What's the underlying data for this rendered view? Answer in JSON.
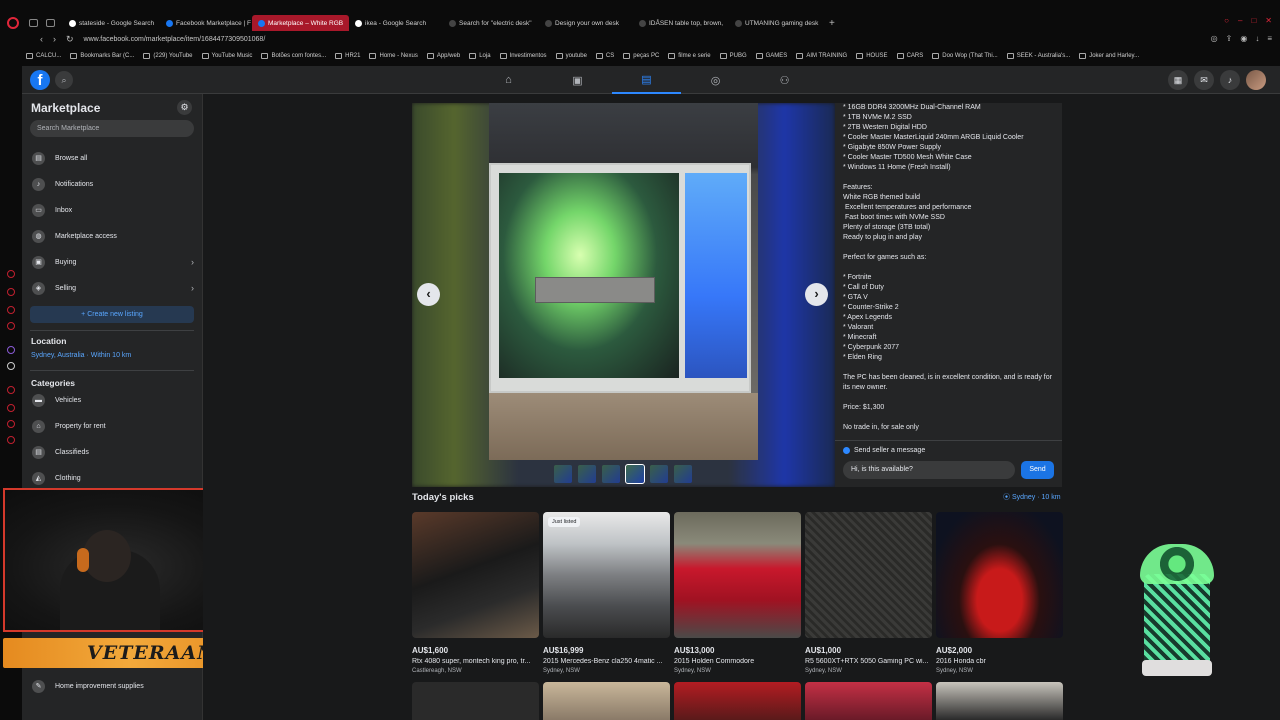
{
  "browser": {
    "tabs": [
      {
        "label": "stateside - Google Search",
        "color": "#ffffff"
      },
      {
        "label": "Facebook Marketplace | F",
        "color": "#1877f2"
      },
      {
        "label": "Marketplace – White RGB",
        "color": "#1877f2"
      },
      {
        "label": "ikea - Google Search",
        "color": "#ffffff"
      },
      {
        "label": "Search for \"electric desk\"",
        "color": "#444444"
      },
      {
        "label": "Design your own desk",
        "color": "#444444"
      },
      {
        "label": "IDÅSEN table top, brown,",
        "color": "#444444"
      },
      {
        "label": "UTMANING gaming desk",
        "color": "#444444"
      }
    ],
    "url": "www.facebook.com/marketplace/item/1684477309501068/",
    "bookmarks": [
      "CALCU...",
      "Bookmarks Bar (C...",
      "(229) YouTube",
      "YouTube Music",
      "Botões com fontes...",
      "HR21",
      "Home - Nexus",
      "App/web",
      "Loja",
      "Investimentos",
      "youtube",
      "CS",
      "peças PC",
      "filme e serie",
      "PUBG",
      "GAMES",
      "AIM TRAINING",
      "HOUSE",
      "CARS",
      "Doo Wop (That Thi...",
      "SEEK - Australia's...",
      "Joker and Harley..."
    ]
  },
  "sidebar": {
    "title": "Marketplace",
    "search_placeholder": "Search Marketplace",
    "items": [
      {
        "label": "Browse all"
      },
      {
        "label": "Notifications"
      },
      {
        "label": "Inbox"
      },
      {
        "label": "Marketplace access"
      },
      {
        "label": "Buying"
      },
      {
        "label": "Selling"
      }
    ],
    "create_label": "+ Create new listing",
    "location_heading": "Location",
    "location_value": "Sydney, Australia · Within 10 km",
    "categories_heading": "Categories",
    "categories": [
      {
        "label": "Vehicles"
      },
      {
        "label": "Property for rent"
      },
      {
        "label": "Classifieds"
      },
      {
        "label": "Clothing"
      }
    ],
    "bottom_item": "Home improvement supplies"
  },
  "overlay": {
    "banner_text": "VETERAAN"
  },
  "listing": {
    "description": "* 16GB DDR4 3200MHz Dual-Channel RAM\n* 1TB NVMe M.2 SSD\n* 2TB Western Digital HDD\n* Cooler Master MasterLiquid 240mm ARGB Liquid Cooler\n* Gigabyte 850W Power Supply\n* Cooler Master TD500 Mesh White Case\n* Windows 11 Home (Fresh Install)\n\nFeatures:\nWhite RGB themed build\n Excellent temperatures and performance\n Fast boot times with NVMe SSD\nPlenty of storage (3TB total)\nReady to plug in and play\n\nPerfect for games such as:\n\n* Fortnite\n* Call of Duty\n* GTA V\n* Counter-Strike 2\n* Apex Legends\n* Valorant\n* Minecraft\n* Cyberpunk 2077\n* Elden Ring\n\nThe PC has been cleaned, is in excellent condition, and is ready for its new owner.\n\nPrice: $1,300\n\nNo trade in, for sale only",
    "message_heading": "Send seller a message",
    "message_value": "Hi, is this available?",
    "send_label": "Send"
  },
  "picks": {
    "title": "Today's picks",
    "location": "Sydney · 10 km",
    "items": [
      {
        "price": "AU$1,600",
        "title": "Rtx 4080 super, montech king pro, tr...",
        "location": "Castlereagh, NSW",
        "badge": ""
      },
      {
        "price": "AU$16,999",
        "title": "2015 Mercedes-Benz cla250 4matic ...",
        "location": "Sydney, NSW",
        "badge": "Just listed"
      },
      {
        "price": "AU$13,000",
        "title": "2015 Holden Commodore",
        "location": "Sydney, NSW",
        "badge": ""
      },
      {
        "price": "AU$1,000",
        "title": "R5 5600XT+RTX 5050 Gaming PC wi...",
        "location": "Sydney, NSW",
        "badge": ""
      },
      {
        "price": "AU$2,000",
        "title": "2016 Honda cbr",
        "location": "Sydney, NSW",
        "badge": ""
      }
    ]
  }
}
